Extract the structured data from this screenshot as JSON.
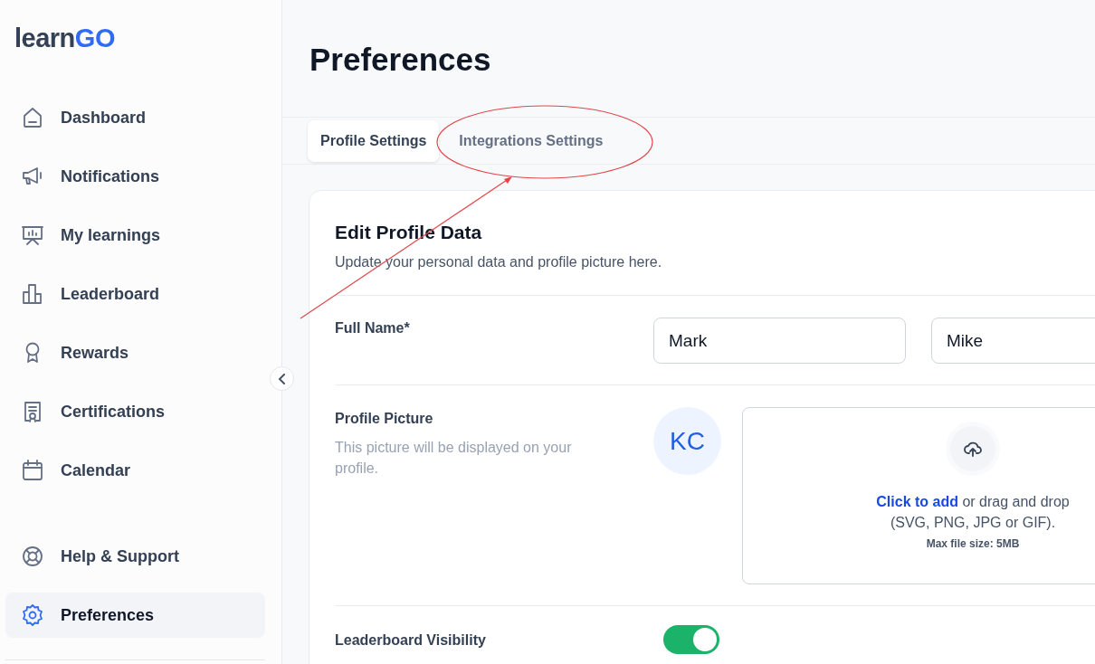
{
  "logo": {
    "text": "learn",
    "accent": "GO"
  },
  "sidebar": {
    "items": [
      {
        "label": "Dashboard",
        "selected": false
      },
      {
        "label": "Notifications",
        "selected": false
      },
      {
        "label": "My learnings",
        "selected": false
      },
      {
        "label": "Leaderboard",
        "selected": false
      },
      {
        "label": "Rewards",
        "selected": false
      },
      {
        "label": "Certifications",
        "selected": false
      },
      {
        "label": "Calendar",
        "selected": false
      }
    ],
    "footer_items": [
      {
        "label": "Help & Support",
        "selected": false
      },
      {
        "label": "Preferences",
        "selected": true
      }
    ]
  },
  "page_title": "Preferences",
  "tabs": [
    {
      "label": "Profile Settings",
      "selected": true
    },
    {
      "label": "Integrations Settings",
      "selected": false
    }
  ],
  "card": {
    "title": "Edit Profile Data",
    "subtitle": "Update your personal data and profile picture here.",
    "full_name": {
      "label": "Full Name*",
      "first": "Mark",
      "last": "Mike"
    },
    "profile_picture": {
      "label": "Profile Picture",
      "hint": "This picture will be displayed on your profile.",
      "initials": "KC",
      "upload": {
        "link": "Click to add",
        "text": " or drag and drop",
        "formats": "(SVG, PNG, JPG or GIF).",
        "max_size": "Max file size: 5MB"
      }
    },
    "leaderboard_visibility": {
      "label": "Leaderboard Visibility",
      "on": true
    }
  }
}
